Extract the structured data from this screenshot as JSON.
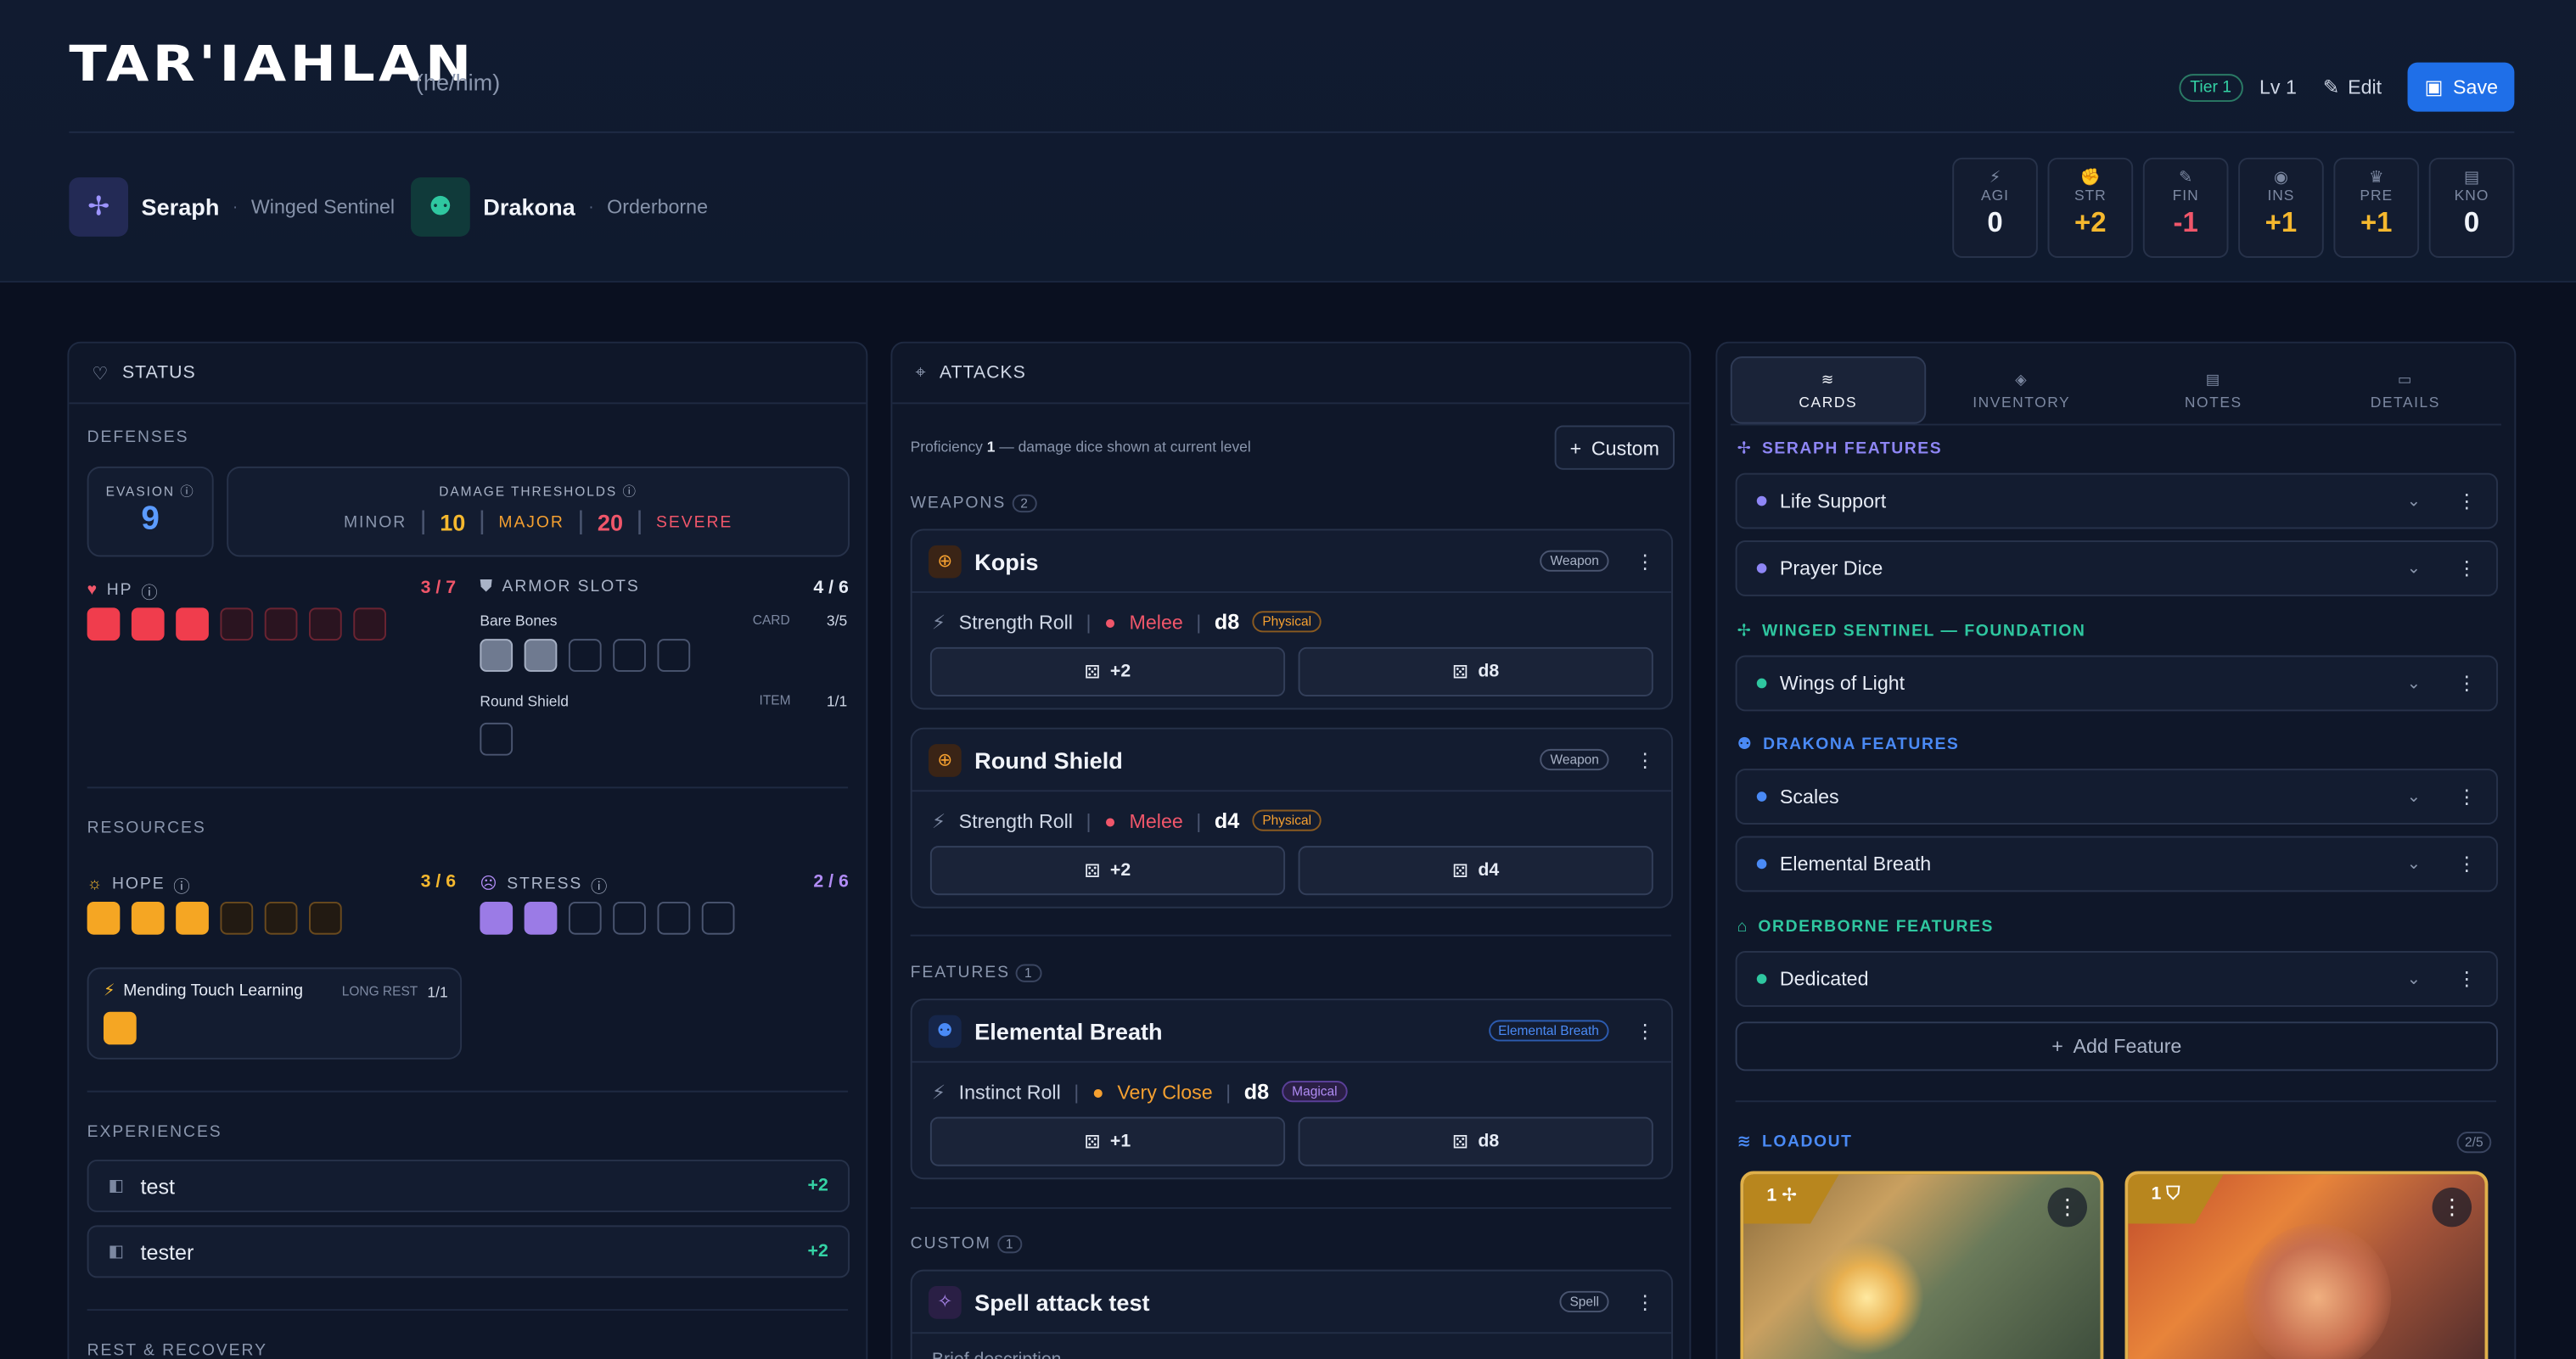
{
  "header": {
    "name": "TAR'IAHLAN",
    "pronouns": "(he/him)",
    "tier": "Tier 1",
    "level": "Lv 1",
    "edit": "Edit",
    "save": "Save",
    "class": {
      "name": "Seraph",
      "sub": "Winged Sentinel"
    },
    "ancestry": {
      "name": "Drakona",
      "sub": "Orderborne"
    },
    "stats": [
      {
        "label": "AGI",
        "value": "0",
        "color": "#f1f4fa"
      },
      {
        "label": "STR",
        "value": "+2",
        "color": "#f5b82e"
      },
      {
        "label": "FIN",
        "value": "-1",
        "color": "#f0566a"
      },
      {
        "label": "INS",
        "value": "+1",
        "color": "#f5b82e"
      },
      {
        "label": "PRE",
        "value": "+1",
        "color": "#f5b82e"
      },
      {
        "label": "KNO",
        "value": "0",
        "color": "#f1f4fa"
      }
    ]
  },
  "status": {
    "title": "STATUS",
    "defenses": "DEFENSES",
    "evasion_label": "EVASION",
    "evasion": "9",
    "thresholds_label": "DAMAGE THRESHOLDS",
    "minor": "MINOR",
    "t1": "10",
    "major": "MAJOR",
    "t2": "20",
    "severe": "SEVERE",
    "hp_label": "HP",
    "hp_count": "3 / 7",
    "hp_filled": 3,
    "hp_total": 7,
    "armor_label": "ARMOR SLOTS",
    "armor_count": "4 / 6",
    "armor1_name": "Bare Bones",
    "armor1_type": "CARD",
    "armor1_count": "3/5",
    "armor2_name": "Round Shield",
    "armor2_type": "ITEM",
    "armor2_count": "1/1",
    "resources": "RESOURCES",
    "hope_label": "HOPE",
    "hope_count": "3 / 6",
    "stress_label": "STRESS",
    "stress_count": "2 / 6",
    "mending_name": "Mending Touch Learning",
    "mending_type": "LONG REST",
    "mending_count": "1/1",
    "experiences": "EXPERIENCES",
    "exp": [
      {
        "name": "test",
        "mod": "+2"
      },
      {
        "name": "tester",
        "mod": "+2"
      }
    ],
    "rest": "REST & RECOVERY"
  },
  "attacks": {
    "title": "ATTACKS",
    "proficiency_prefix": "Proficiency",
    "proficiency_value": "1",
    "proficiency_suffix": "— damage dice shown at current level",
    "custom_button": "Custom",
    "weapons_label": "WEAPONS",
    "weapons_count": "2",
    "features_label": "FEATURES",
    "features_count": "1",
    "custom_label": "CUSTOM",
    "custom_count": "1",
    "items": [
      {
        "name": "Kopis",
        "tag": "Weapon",
        "roll": "Strength Roll",
        "range": "Melee",
        "die": "d8",
        "dtype": "Physical",
        "hit": "+2",
        "dmg": "d8"
      },
      {
        "name": "Round Shield",
        "tag": "Weapon",
        "roll": "Strength Roll",
        "range": "Melee",
        "die": "d4",
        "dtype": "Physical",
        "hit": "+2",
        "dmg": "d4"
      },
      {
        "name": "Elemental Breath",
        "tag": "Elemental Breath",
        "roll": "Instinct Roll",
        "range": "Very Close",
        "die": "d8",
        "dtype": "Magical",
        "hit": "+1",
        "dmg": "d8"
      },
      {
        "name": "Spell attack test",
        "tag": "Spell",
        "desc": "Brief description"
      }
    ]
  },
  "cards": {
    "tabs": [
      "CARDS",
      "INVENTORY",
      "NOTES",
      "DETAILS"
    ],
    "groups": [
      {
        "title": "SERAPH FEATURES",
        "color": "#8e86f5",
        "items": [
          "Life Support",
          "Prayer Dice"
        ]
      },
      {
        "title": "WINGED SENTINEL — FOUNDATION",
        "color": "#2fc7a0",
        "items": [
          "Wings of Light"
        ]
      },
      {
        "title": "DRAKONA FEATURES",
        "color": "#4a8af5",
        "items": [
          "Scales",
          "Elemental Breath"
        ]
      },
      {
        "title": "ORDERBORNE FEATURES",
        "color": "#2fc7a0",
        "items": [
          "Dedicated"
        ]
      }
    ],
    "add_feature": "Add Feature",
    "loadout": "LOADOUT",
    "loadout_count": "2/5",
    "card_levels": [
      "1",
      "1"
    ]
  }
}
